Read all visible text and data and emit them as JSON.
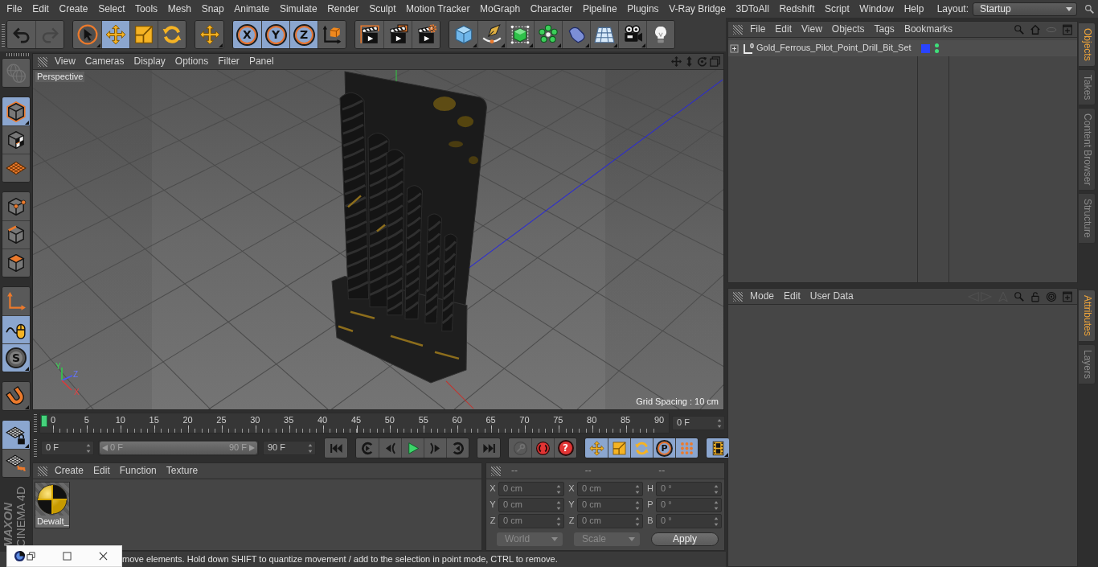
{
  "menu_bar": {
    "items": [
      "File",
      "Edit",
      "Create",
      "Select",
      "Tools",
      "Mesh",
      "Snap",
      "Animate",
      "Simulate",
      "Render",
      "Sculpt",
      "Motion Tracker",
      "MoGraph",
      "Character",
      "Pipeline",
      "Plugins",
      "V-Ray Bridge",
      "3DToAll",
      "Redshift",
      "Script",
      "Window",
      "Help"
    ],
    "layout_label": "Layout:",
    "layout_value": "Startup"
  },
  "toolbar": [
    {
      "buttons": [
        {
          "kind": "undo",
          "selected": false,
          "disabled": false,
          "flyout": false
        },
        {
          "kind": "redo",
          "selected": false,
          "disabled": true,
          "flyout": false
        }
      ]
    },
    {
      "buttons": [
        {
          "kind": "live-select",
          "selected": false,
          "disabled": false,
          "flyout": true
        },
        {
          "kind": "move",
          "selected": true,
          "disabled": false,
          "flyout": false
        },
        {
          "kind": "scale",
          "selected": false,
          "disabled": false,
          "flyout": false
        },
        {
          "kind": "rotate",
          "selected": false,
          "disabled": false,
          "flyout": false
        }
      ]
    },
    {
      "buttons": [
        {
          "kind": "recent-tool",
          "selected": false,
          "disabled": false,
          "flyout": true
        }
      ]
    },
    {
      "buttons": [
        {
          "kind": "axis-lock",
          "label": "X",
          "selected": true,
          "disabled": false,
          "flyout": false
        },
        {
          "kind": "axis-lock",
          "label": "Y",
          "selected": true,
          "disabled": false,
          "flyout": false
        },
        {
          "kind": "axis-lock",
          "label": "Z",
          "selected": true,
          "disabled": false,
          "flyout": false
        },
        {
          "kind": "coordinate-system",
          "selected": false,
          "disabled": false,
          "flyout": false
        }
      ]
    },
    {
      "buttons": [
        {
          "kind": "render-view",
          "selected": false,
          "disabled": false,
          "flyout": false
        },
        {
          "kind": "render-picture",
          "selected": false,
          "disabled": false,
          "flyout": false
        },
        {
          "kind": "render-settings",
          "selected": false,
          "disabled": false,
          "flyout": false
        }
      ]
    },
    {
      "buttons": [
        {
          "kind": "cube",
          "selected": false,
          "disabled": false,
          "flyout": true
        },
        {
          "kind": "pen",
          "selected": false,
          "disabled": false,
          "flyout": true
        },
        {
          "kind": "subdivision",
          "selected": false,
          "disabled": false,
          "flyout": true
        },
        {
          "kind": "cloner",
          "selected": false,
          "disabled": false,
          "flyout": true
        },
        {
          "kind": "deformer",
          "selected": false,
          "disabled": false,
          "flyout": true
        },
        {
          "kind": "floor",
          "selected": false,
          "disabled": false,
          "flyout": true
        },
        {
          "kind": "camera",
          "selected": false,
          "disabled": false,
          "flyout": true
        },
        {
          "kind": "light",
          "selected": false,
          "disabled": false,
          "flyout": false
        }
      ]
    }
  ],
  "left_toolbar": [
    {
      "buttons": [
        {
          "kind": "workplane-globe",
          "selected": false,
          "disabled": true,
          "flyout": false
        }
      ]
    },
    {
      "buttons": [
        {
          "kind": "model",
          "selected": true,
          "disabled": false,
          "flyout": true
        },
        {
          "kind": "texture",
          "selected": false,
          "disabled": false,
          "flyout": false
        },
        {
          "kind": "workplane",
          "selected": false,
          "disabled": false,
          "flyout": false
        }
      ]
    },
    {
      "buttons": [
        {
          "kind": "points",
          "selected": false,
          "disabled": false,
          "flyout": false
        },
        {
          "kind": "edges",
          "selected": false,
          "disabled": false,
          "flyout": false
        },
        {
          "kind": "polygons",
          "selected": false,
          "disabled": false,
          "flyout": false
        }
      ]
    },
    {
      "buttons": [
        {
          "kind": "axis",
          "selected": false,
          "disabled": false,
          "flyout": false
        },
        {
          "kind": "tweak",
          "selected": true,
          "disabled": false,
          "flyout": false
        },
        {
          "kind": "solo",
          "label": "S",
          "selected": true,
          "disabled": false,
          "flyout": true
        }
      ]
    },
    {
      "buttons": [
        {
          "kind": "snap",
          "selected": false,
          "disabled": false,
          "flyout": true
        }
      ]
    },
    {
      "buttons": [
        {
          "kind": "workplane-lock",
          "selected": true,
          "disabled": false,
          "flyout": true
        },
        {
          "kind": "workplane-rotate",
          "selected": false,
          "disabled": false,
          "flyout": false
        }
      ]
    }
  ],
  "logo": {
    "brand": "MAXON",
    "product": "CINEMA 4D"
  },
  "viewport": {
    "menu": [
      "View",
      "Cameras",
      "Display",
      "Options",
      "Filter",
      "Panel"
    ],
    "camera": "Perspective",
    "grid_spacing": "Grid Spacing : 10 cm",
    "gizmo_labels": [
      "Y",
      "Z",
      "X"
    ]
  },
  "timeline": {
    "labels": [
      "0",
      "5",
      "10",
      "15",
      "20",
      "25",
      "30",
      "35",
      "40",
      "45",
      "50",
      "55",
      "60",
      "65",
      "70",
      "75",
      "80",
      "85",
      "90"
    ],
    "level": 0,
    "current_frame": "0 F"
  },
  "transport": {
    "start": "0 F",
    "range": {
      "start_label": "0 F",
      "end_label": "90 F",
      "level": 1
    },
    "end": "90 F",
    "groups": [
      {
        "buttons": [
          {
            "kind": "goto-start",
            "selected": false,
            "disabled": false,
            "flyout": false
          }
        ]
      },
      {
        "buttons": [
          {
            "kind": "prev-key",
            "selected": false,
            "disabled": false,
            "flyout": false
          },
          {
            "kind": "prev-frame",
            "selected": false,
            "disabled": false,
            "flyout": false
          },
          {
            "kind": "play",
            "selected": false,
            "disabled": false,
            "flyout": false
          },
          {
            "kind": "next-frame",
            "selected": false,
            "disabled": false,
            "flyout": false
          },
          {
            "kind": "next-key",
            "selected": false,
            "disabled": false,
            "flyout": false
          }
        ]
      },
      {
        "buttons": [
          {
            "kind": "goto-end",
            "selected": false,
            "disabled": false,
            "flyout": false
          }
        ]
      },
      {
        "buttons": [
          {
            "kind": "record",
            "selected": false,
            "disabled": true,
            "flyout": false
          },
          {
            "kind": "autokey",
            "selected": false,
            "disabled": false,
            "flyout": false
          },
          {
            "kind": "keyframe-selection",
            "label": "?",
            "selected": false,
            "disabled": false,
            "flyout": false
          }
        ]
      },
      {
        "buttons": [
          {
            "kind": "key-position",
            "selected": true,
            "disabled": false,
            "flyout": false
          },
          {
            "kind": "key-scale",
            "selected": true,
            "disabled": false,
            "flyout": false
          },
          {
            "kind": "key-rotation",
            "selected": true,
            "disabled": false,
            "flyout": false
          },
          {
            "kind": "key-parameter",
            "label": "P",
            "selected": true,
            "disabled": false,
            "flyout": false
          },
          {
            "kind": "key-pla",
            "selected": true,
            "disabled": false,
            "flyout": false
          }
        ]
      },
      {
        "buttons": [
          {
            "kind": "timeline-window",
            "selected": true,
            "disabled": false,
            "flyout": true
          }
        ]
      }
    ]
  },
  "materials": {
    "menu": [
      "Create",
      "Edit",
      "Function",
      "Texture"
    ],
    "items": [
      {
        "name": "Dewalt_",
        "selected": true
      }
    ]
  },
  "coordinates": {
    "headers": [
      "--",
      "--",
      "--"
    ],
    "rows": [
      {
        "fields": [
          {
            "label": "X",
            "value": "0 cm"
          },
          {
            "label": "X",
            "value": "0 cm"
          },
          {
            "label": "H",
            "value": "0 °"
          }
        ]
      },
      {
        "fields": [
          {
            "label": "Y",
            "value": "0 cm"
          },
          {
            "label": "Y",
            "value": "0 cm"
          },
          {
            "label": "P",
            "value": "0 °"
          }
        ]
      },
      {
        "fields": [
          {
            "label": "Z",
            "value": "0 cm"
          },
          {
            "label": "Z",
            "value": "0 cm"
          },
          {
            "label": "B",
            "value": "0 °"
          }
        ]
      }
    ],
    "dropdowns": [
      {
        "value": "World",
        "disabled": true
      },
      {
        "value": "Scale",
        "disabled": true
      }
    ],
    "apply": "Apply"
  },
  "status_bar": {
    "text": "move elements. Hold down SHIFT to quantize movement / add to the selection in point mode, CTRL to remove."
  },
  "objects": {
    "menu": [
      "File",
      "Edit",
      "View",
      "Objects",
      "Tags",
      "Bookmarks"
    ],
    "tools": [
      {
        "kind": "search",
        "disabled": false
      },
      {
        "kind": "home",
        "disabled": false
      },
      {
        "kind": "filter",
        "disabled": true
      },
      {
        "kind": "new-window",
        "disabled": false
      }
    ],
    "rows": [
      {
        "name": "Gold_Ferrous_Pilot_Point_Drill_Bit_Set",
        "icon_label": "0",
        "expanded": false,
        "color": "#2a44ff",
        "editor_visible": true,
        "render_visible": true
      }
    ]
  },
  "attributes": {
    "menu": [
      "Mode",
      "Edit",
      "User Data"
    ],
    "tools": [
      {
        "kind": "history",
        "disabled": true
      },
      {
        "kind": "up",
        "disabled": true
      },
      {
        "kind": "search",
        "disabled": false
      },
      {
        "kind": "lock",
        "disabled": false
      },
      {
        "kind": "target",
        "disabled": false
      },
      {
        "kind": "new-window",
        "disabled": false
      }
    ]
  },
  "side_tabs": {
    "upper": [
      {
        "label": "Objects",
        "selected": true
      },
      {
        "label": "Takes",
        "selected": false
      },
      {
        "label": "Content Browser",
        "selected": false
      },
      {
        "label": "Structure",
        "selected": false
      }
    ],
    "lower": [
      {
        "label": "Attributes",
        "selected": true
      },
      {
        "label": "Layers",
        "selected": false
      }
    ]
  }
}
